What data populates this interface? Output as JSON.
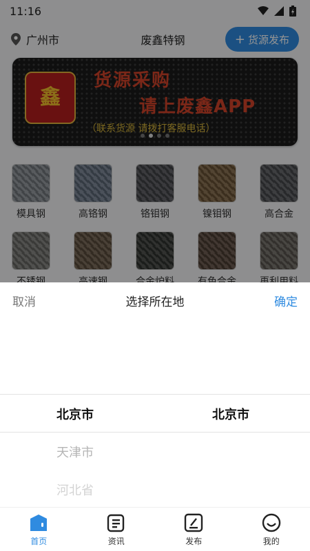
{
  "status": {
    "time": "11:16"
  },
  "header": {
    "location": "广州市",
    "title": "废鑫特钢",
    "publish_label": "货源发布",
    "publish_plus": "+"
  },
  "banner": {
    "logo_text": "鑫",
    "line1": "货源采购",
    "line2": "请上废鑫APP",
    "line3": "（联系货源 请拨打客服电话）"
  },
  "categories": [
    {
      "label": "模具钢",
      "color": "#8a8f95"
    },
    {
      "label": "高铬钢",
      "color": "#6f7c8d"
    },
    {
      "label": "铬钼钢",
      "color": "#4e5054"
    },
    {
      "label": "镍钼钢",
      "color": "#7d6240"
    },
    {
      "label": "高合金",
      "color": "#55585a"
    },
    {
      "label": "不锈钢",
      "color": "#7a7a76"
    },
    {
      "label": "高速钢",
      "color": "#6d5b48"
    },
    {
      "label": "合金炉料",
      "color": "#3b3d3a"
    },
    {
      "label": "有色合金",
      "color": "#5c4a3e"
    },
    {
      "label": "再利用料",
      "color": "#6b6660"
    }
  ],
  "picker": {
    "cancel": "取消",
    "title": "选择所在地",
    "confirm": "确定",
    "province_selected": "北京市",
    "city_selected": "北京市",
    "province_next1": "天津市",
    "province_next2": "河北省"
  },
  "tabs": [
    {
      "label": "首页",
      "icon": "home-icon",
      "active": true
    },
    {
      "label": "资讯",
      "icon": "news-icon"
    },
    {
      "label": "发布",
      "icon": "publish-icon"
    },
    {
      "label": "我的",
      "icon": "profile-icon"
    }
  ],
  "colors": {
    "accent": "#2f8be0"
  }
}
